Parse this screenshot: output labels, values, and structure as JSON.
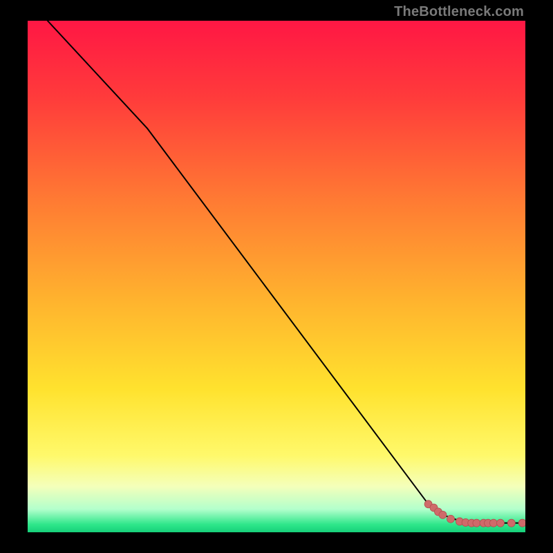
{
  "watermark": "TheBottleneck.com",
  "colors": {
    "frame": "#000000",
    "watermark": "#7a7a7a",
    "curve": "#000000",
    "marker_fill": "#cf6a6a",
    "marker_stroke": "#b24f4f"
  },
  "chart_data": {
    "type": "line",
    "title": "",
    "xlabel": "",
    "ylabel": "",
    "xlim": [
      0,
      100
    ],
    "ylim": [
      0,
      100
    ],
    "grid": false,
    "legend": false,
    "background_gradient": {
      "orientation": "vertical",
      "stops": [
        {
          "offset": 0.0,
          "color": "#ff1744"
        },
        {
          "offset": 0.15,
          "color": "#ff3b3b"
        },
        {
          "offset": 0.35,
          "color": "#ff7a33"
        },
        {
          "offset": 0.55,
          "color": "#ffb42e"
        },
        {
          "offset": 0.72,
          "color": "#ffe22e"
        },
        {
          "offset": 0.85,
          "color": "#fff96b"
        },
        {
          "offset": 0.91,
          "color": "#f4ffba"
        },
        {
          "offset": 0.955,
          "color": "#b3ffcc"
        },
        {
          "offset": 0.985,
          "color": "#2ee68a"
        },
        {
          "offset": 1.0,
          "color": "#17d07a"
        }
      ]
    },
    "series": [
      {
        "name": "bottleneck-curve",
        "kind": "line",
        "x": [
          4,
          24,
          80.5,
          82,
          84,
          86,
          88,
          90,
          92,
          94,
          96,
          98,
          100
        ],
        "y": [
          100,
          79,
          5.5,
          4.2,
          3.2,
          2.5,
          2.1,
          1.9,
          1.8,
          1.8,
          1.8,
          1.8,
          1.8
        ]
      },
      {
        "name": "markers",
        "kind": "scatter",
        "x": [
          80.5,
          81.6,
          82.5,
          83.4,
          85.0,
          86.8,
          88.0,
          89.2,
          90.2,
          91.6,
          92.5,
          93.6,
          95.0,
          97.2,
          99.4
        ],
        "y": [
          5.5,
          4.8,
          4.0,
          3.4,
          2.6,
          2.1,
          1.9,
          1.8,
          1.8,
          1.8,
          1.8,
          1.8,
          1.8,
          1.8,
          1.8
        ]
      }
    ]
  }
}
